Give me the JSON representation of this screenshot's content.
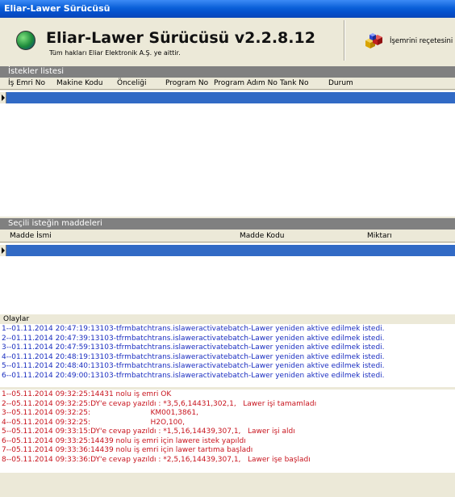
{
  "window": {
    "title": "Eliar-Lawer Sürücüsü"
  },
  "header": {
    "app_title": "Eliar-Lawer Sürücüsü v2.2.8.12",
    "copyright": "Tüm hakları Eliar Elektronik A.Ş. ye aittir.",
    "recipe_button": {
      "label": "İşemrini reçetesini",
      "icon": "colored-cubes-icon"
    }
  },
  "requests": {
    "section_title": "İstekler listesi",
    "columns": [
      "İş Emri No",
      "Makine Kodu",
      "Önceliği",
      "Program No",
      "Program Adım No",
      "Tank No",
      "Durum"
    ]
  },
  "items": {
    "section_title": "Seçili isteğin maddeleri",
    "columns": [
      "Madde İsmi",
      "Madde Kodu",
      "Miktarı"
    ]
  },
  "events": {
    "label": "Olaylar",
    "blue_lines": [
      "1--01.11.2014 20:47:19:13103-tfrmbatchtrans.islaweractivatebatch-Lawer yeniden aktive edilmek istedi.",
      "2--01.11.2014 20:47:39:13103-tfrmbatchtrans.islaweractivatebatch-Lawer yeniden aktive edilmek istedi.",
      "3--01.11.2014 20:47:59:13103-tfrmbatchtrans.islaweractivatebatch-Lawer yeniden aktive edilmek istedi.",
      "4--01.11.2014 20:48:19:13103-tfrmbatchtrans.islaweractivatebatch-Lawer yeniden aktive edilmek istedi.",
      "5--01.11.2014 20:48:40:13103-tfrmbatchtrans.islaweractivatebatch-Lawer yeniden aktive edilmek istedi.",
      "6--01.11.2014 20:49:00:13103-tfrmbatchtrans.islaweractivatebatch-Lawer yeniden aktive edilmek istedi."
    ],
    "red_lines": [
      "1--05.11.2014 09:32:25:14431 nolu iş emri OK",
      "2--05.11.2014 09:32:25:DY'e cevap yazıldı : *3,5,6,14431,302,1,   Lawer işi tamamladı",
      "3--05.11.2014 09:32:25:                          KM001,3861,",
      "4--05.11.2014 09:32:25:                          H2O,100,",
      "5--05.11.2014 09:33:15:DY'e cevap yazıldı : *1,5,16,14439,307,1,   Lawer işi aldı",
      "6--05.11.2014 09:33:25:14439 nolu iş emri için lawere istek yapıldı",
      "7--05.11.2014 09:33:36:14439 nolu iş emri için lawer tartıma başladı",
      "8--05.11.2014 09:33:36:DY'e cevap yazıldı : *2,5,16,14439,307,1,   Lawer işe başladı"
    ]
  }
}
